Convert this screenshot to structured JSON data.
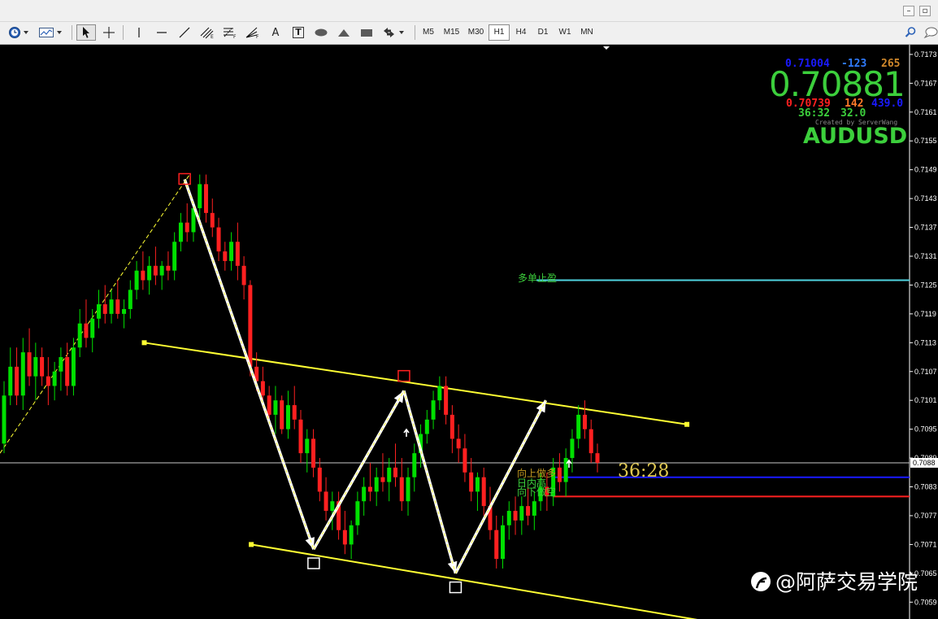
{
  "window": {
    "minimize_icon": "minimize-icon",
    "restore_icon": "restore-icon"
  },
  "toolbar": {
    "timeframes": [
      {
        "label": "M5"
      },
      {
        "label": "M15"
      },
      {
        "label": "M30"
      },
      {
        "label": "H1",
        "active": true
      },
      {
        "label": "H4"
      },
      {
        "label": "D1"
      },
      {
        "label": "W1"
      },
      {
        "label": "MN"
      }
    ],
    "text_tool_label": "A",
    "label_tool_label": "T"
  },
  "price_axis": {
    "labels": [
      "0.7173",
      "0.7167",
      "0.7161",
      "0.7155",
      "0.7149",
      "0.7143",
      "0.7137",
      "0.7131",
      "0.7125",
      "0.7119",
      "0.7113",
      "0.7107",
      "0.7101",
      "0.7095",
      "0.7089",
      "0.7083",
      "0.7077",
      "0.7071",
      "0.7065",
      "0.7059"
    ],
    "current_price_label": "0.7088"
  },
  "info_panel": {
    "ask": "0.71004",
    "spread_points": "-123",
    "range_points": "265",
    "bid_big": "0.70881",
    "low": "0.70739",
    "change_points": "142",
    "extra_value": "439.0",
    "time_left": "36:32",
    "value2": "32.0",
    "credit": "Created by ServerWang",
    "symbol": "AUDUSD",
    "colors": {
      "ask": "#1a1aff",
      "spread": "#2f7bff",
      "range": "#d2892b",
      "big": "#3ccf3c",
      "low": "#ff2020",
      "change": "#ff7a2a",
      "extra": "#1a1aff",
      "time": "#3ccf3c",
      "value2": "#3ccf3c",
      "symbol": "#3ccf3c"
    }
  },
  "chart_labels": {
    "take_profit_label": "多单止盈",
    "countdown": "36:28",
    "trend_up_long": "向上做多",
    "signal_line": "日内高",
    "trend_down_short": "向下做空"
  },
  "watermark": {
    "text": "@阿萨交易学院"
  },
  "chart_data": {
    "type": "candlestick",
    "symbol": "AUDUSD",
    "timeframe": "H1",
    "ylim": [
      0.7056,
      0.7174
    ],
    "candles": [
      [
        0.7092,
        0.7105,
        0.709,
        0.7102
      ],
      [
        0.7102,
        0.7112,
        0.71,
        0.7108
      ],
      [
        0.7108,
        0.7112,
        0.71,
        0.7102
      ],
      [
        0.7102,
        0.7114,
        0.7099,
        0.7111
      ],
      [
        0.7111,
        0.7116,
        0.7104,
        0.7106
      ],
      [
        0.7106,
        0.7113,
        0.7101,
        0.711
      ],
      [
        0.711,
        0.7112,
        0.7104,
        0.7106
      ],
      [
        0.7106,
        0.711,
        0.71,
        0.7104
      ],
      [
        0.7104,
        0.7109,
        0.7101,
        0.7107
      ],
      [
        0.7107,
        0.7112,
        0.7103,
        0.711
      ],
      [
        0.711,
        0.7113,
        0.7102,
        0.7104
      ],
      [
        0.7104,
        0.7114,
        0.7102,
        0.7112
      ],
      [
        0.7112,
        0.712,
        0.711,
        0.7117
      ],
      [
        0.7117,
        0.7122,
        0.7112,
        0.7114
      ],
      [
        0.7114,
        0.712,
        0.7111,
        0.7118
      ],
      [
        0.7118,
        0.7124,
        0.7116,
        0.7121
      ],
      [
        0.7121,
        0.7125,
        0.7117,
        0.7119
      ],
      [
        0.7119,
        0.7124,
        0.7117,
        0.7122
      ],
      [
        0.7122,
        0.7126,
        0.7118,
        0.7119
      ],
      [
        0.7119,
        0.7122,
        0.7116,
        0.712
      ],
      [
        0.712,
        0.7126,
        0.7118,
        0.7124
      ],
      [
        0.7124,
        0.713,
        0.7122,
        0.7128
      ],
      [
        0.7128,
        0.7132,
        0.7124,
        0.7126
      ],
      [
        0.7126,
        0.7131,
        0.7123,
        0.7129
      ],
      [
        0.7129,
        0.7133,
        0.7125,
        0.7127
      ],
      [
        0.7127,
        0.713,
        0.7124,
        0.7129
      ],
      [
        0.7129,
        0.7132,
        0.7126,
        0.7128
      ],
      [
        0.7128,
        0.7136,
        0.7126,
        0.7134
      ],
      [
        0.7134,
        0.714,
        0.7132,
        0.7138
      ],
      [
        0.7138,
        0.7142,
        0.7134,
        0.7136
      ],
      [
        0.7136,
        0.7142,
        0.7134,
        0.7141
      ],
      [
        0.7141,
        0.7148,
        0.7139,
        0.7146
      ],
      [
        0.7146,
        0.7148,
        0.7138,
        0.714
      ],
      [
        0.714,
        0.7143,
        0.7135,
        0.7137
      ],
      [
        0.7137,
        0.7139,
        0.713,
        0.7132
      ],
      [
        0.7132,
        0.7134,
        0.7128,
        0.713
      ],
      [
        0.713,
        0.7136,
        0.7128,
        0.7134
      ],
      [
        0.7134,
        0.7138,
        0.7126,
        0.7129
      ],
      [
        0.7129,
        0.7131,
        0.7122,
        0.7125
      ],
      [
        0.7125,
        0.7126,
        0.7106,
        0.7108
      ],
      [
        0.7108,
        0.7111,
        0.7103,
        0.7105
      ],
      [
        0.7105,
        0.7108,
        0.71,
        0.7102
      ],
      [
        0.7102,
        0.7104,
        0.7096,
        0.7098
      ],
      [
        0.7098,
        0.7104,
        0.7094,
        0.7101
      ],
      [
        0.7101,
        0.7102,
        0.7094,
        0.7095
      ],
      [
        0.7095,
        0.7103,
        0.7093,
        0.71
      ],
      [
        0.71,
        0.7104,
        0.7095,
        0.7097
      ],
      [
        0.7097,
        0.7099,
        0.7088,
        0.709
      ],
      [
        0.709,
        0.7095,
        0.7086,
        0.7093
      ],
      [
        0.7093,
        0.7095,
        0.7085,
        0.7087
      ],
      [
        0.7087,
        0.7089,
        0.708,
        0.7082
      ],
      [
        0.7082,
        0.7085,
        0.7076,
        0.7078
      ],
      [
        0.7078,
        0.7082,
        0.7074,
        0.708
      ],
      [
        0.708,
        0.7082,
        0.7072,
        0.7074
      ],
      [
        0.7074,
        0.7078,
        0.7069,
        0.7071
      ],
      [
        0.7071,
        0.7076,
        0.7068,
        0.7075
      ],
      [
        0.7075,
        0.7082,
        0.7073,
        0.708
      ],
      [
        0.708,
        0.7085,
        0.7077,
        0.7083
      ],
      [
        0.7083,
        0.7088,
        0.708,
        0.7082
      ],
      [
        0.7082,
        0.7087,
        0.7079,
        0.7085
      ],
      [
        0.7085,
        0.709,
        0.7082,
        0.7084
      ],
      [
        0.7084,
        0.7089,
        0.708,
        0.7087
      ],
      [
        0.7087,
        0.7092,
        0.7083,
        0.7085
      ],
      [
        0.7085,
        0.7089,
        0.7078,
        0.708
      ],
      [
        0.708,
        0.7087,
        0.7077,
        0.7085
      ],
      [
        0.7085,
        0.7092,
        0.7082,
        0.709
      ],
      [
        0.709,
        0.7096,
        0.7087,
        0.7094
      ],
      [
        0.7094,
        0.7099,
        0.7092,
        0.7097
      ],
      [
        0.7097,
        0.7103,
        0.7095,
        0.7101
      ],
      [
        0.7101,
        0.7106,
        0.7099,
        0.7104
      ],
      [
        0.7104,
        0.7106,
        0.7096,
        0.7098
      ],
      [
        0.7098,
        0.71,
        0.709,
        0.7093
      ],
      [
        0.7093,
        0.7096,
        0.7088,
        0.7091
      ],
      [
        0.7091,
        0.7094,
        0.7084,
        0.7086
      ],
      [
        0.7086,
        0.7089,
        0.708,
        0.7082
      ],
      [
        0.7082,
        0.7086,
        0.7078,
        0.7085
      ],
      [
        0.7085,
        0.7087,
        0.7077,
        0.7079
      ],
      [
        0.7079,
        0.7083,
        0.7072,
        0.7074
      ],
      [
        0.7074,
        0.7077,
        0.7066,
        0.7068
      ],
      [
        0.7068,
        0.7077,
        0.7066,
        0.7075
      ],
      [
        0.7075,
        0.708,
        0.7072,
        0.7078
      ],
      [
        0.7078,
        0.7081,
        0.7073,
        0.7076
      ],
      [
        0.7076,
        0.7081,
        0.7073,
        0.7079
      ],
      [
        0.7079,
        0.7083,
        0.7075,
        0.7077
      ],
      [
        0.7077,
        0.7082,
        0.7074,
        0.708
      ],
      [
        0.708,
        0.7086,
        0.7078,
        0.7083
      ],
      [
        0.7083,
        0.7086,
        0.7078,
        0.7081
      ],
      [
        0.7081,
        0.7089,
        0.7079,
        0.7087
      ],
      [
        0.7087,
        0.709,
        0.7082,
        0.7084
      ],
      [
        0.7084,
        0.7091,
        0.7081,
        0.7089
      ],
      [
        0.7089,
        0.7095,
        0.7086,
        0.7093
      ],
      [
        0.7093,
        0.71,
        0.7091,
        0.7098
      ],
      [
        0.7098,
        0.7101,
        0.7093,
        0.7095
      ],
      [
        0.7095,
        0.7097,
        0.7088,
        0.709
      ],
      [
        0.709,
        0.7092,
        0.7086,
        0.7088
      ]
    ],
    "horizontal_lines": [
      {
        "name": "take-profit-line",
        "price": 0.7126,
        "color": "#4fd4e0"
      },
      {
        "name": "current-price-line",
        "price": 0.7088,
        "color": "#c8c8c8"
      },
      {
        "name": "blue-level-line",
        "price": 0.7085,
        "color": "#1a1aff"
      },
      {
        "name": "red-level-line",
        "price": 0.7081,
        "color": "#ff2020"
      }
    ],
    "channel_lines": [
      {
        "name": "upper-channel-line",
        "from": [
          10,
          0.7113
        ],
        "to": [
          98,
          0.7096
        ],
        "color": "#ffff33"
      },
      {
        "name": "lower-channel-line",
        "from": [
          18,
          0.7071
        ],
        "to": [
          110,
          0.7052
        ],
        "color": "#ffff33"
      }
    ],
    "zigzag_arrows": [
      {
        "from": [
          14,
          0.7147
        ],
        "to": [
          24,
          0.707
        ]
      },
      {
        "from": [
          24,
          0.707
        ],
        "to": [
          31,
          0.7103
        ]
      },
      {
        "from": [
          31,
          0.7103
        ],
        "to": [
          35,
          0.7065
        ]
      },
      {
        "from": [
          35,
          0.7065
        ],
        "to": [
          42,
          0.7101
        ]
      }
    ],
    "pivot_boxes": [
      {
        "at": [
          14,
          0.7147
        ],
        "color": "#ff2020"
      },
      {
        "at": [
          24,
          0.7067
        ],
        "color": "#ffffff"
      },
      {
        "at": [
          31,
          0.7106
        ],
        "color": "#ff2020"
      },
      {
        "at": [
          35,
          0.7062
        ],
        "color": "#ffffff"
      }
    ],
    "trend_line": {
      "from": [
        0,
        0.709
      ],
      "to": [
        14,
        0.7148
      ],
      "color": "#ffff33"
    },
    "colors": {
      "bull": "#00e000",
      "bear": "#ff2020",
      "background": "#000000",
      "axis": "#ffffff"
    }
  }
}
